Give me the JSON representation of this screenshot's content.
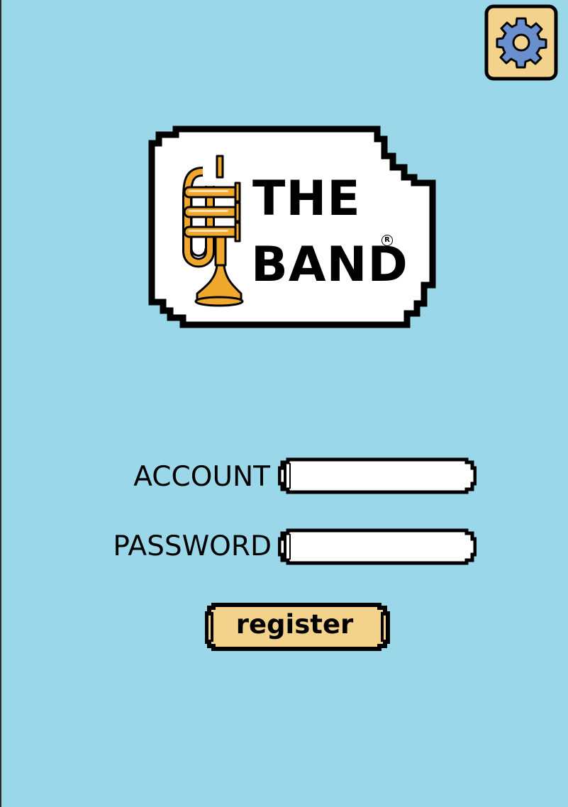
{
  "brand": {
    "line1": "THE",
    "line2": "BAND",
    "registered_mark": "R"
  },
  "form": {
    "account_label": "ACCOUNT",
    "account_value": "",
    "password_label": "PASSWORD",
    "password_value": "",
    "submit_label": "register"
  },
  "icons": {
    "settings": "gear-icon",
    "logo": "trumpet-icon"
  },
  "colors": {
    "background": "#9ad8e9",
    "button_fill": "#f3d38b",
    "gear_fill": "#6a8fce",
    "trumpet_gold": "#f0a82c",
    "outline": "#000000"
  }
}
